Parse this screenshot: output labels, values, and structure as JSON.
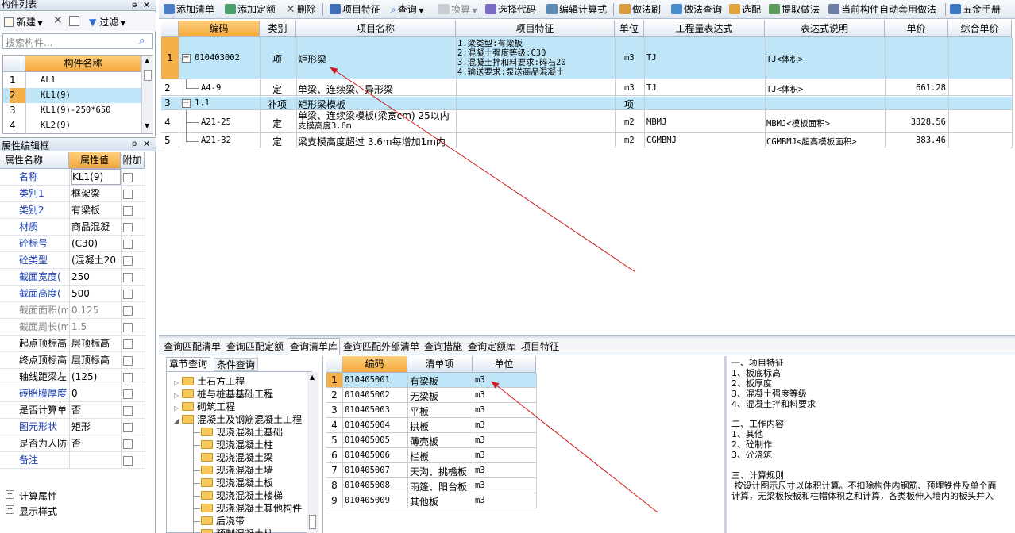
{
  "component_panel": {
    "title": "构件列表",
    "pin": "ᵽ",
    "close": "✕",
    "toolbar": {
      "new": "新建",
      "delete": "✕",
      "filter": "过滤"
    },
    "search_placeholder": "搜索构件...",
    "col_header": "构件名称",
    "items": [
      {
        "no": "1",
        "name": "AL1"
      },
      {
        "no": "2",
        "name": "KL1(9)"
      },
      {
        "no": "3",
        "name": "KL1(9)-250*650"
      },
      {
        "no": "4",
        "name": "KL2(9)"
      }
    ]
  },
  "property_panel": {
    "title": "属性编辑框",
    "headers": {
      "name": "属性名称",
      "value": "属性值",
      "extra": "附加"
    },
    "rows": [
      {
        "no": "1",
        "name": "名称",
        "value": "KL1(9)"
      },
      {
        "no": "2",
        "name": "类别1",
        "value": "框架梁"
      },
      {
        "no": "3",
        "name": "类别2",
        "value": "有梁板"
      },
      {
        "no": "4",
        "name": "材质",
        "value": "商品混凝"
      },
      {
        "no": "5",
        "name": "砼标号",
        "value": "(C30)"
      },
      {
        "no": "6",
        "name": "砼类型",
        "value": "(混凝土20"
      },
      {
        "no": "7",
        "name": "截面宽度(",
        "value": "250"
      },
      {
        "no": "8",
        "name": "截面高度(",
        "value": "500"
      },
      {
        "no": "9",
        "name": "截面面积(m",
        "value": "0.125"
      },
      {
        "no": "10",
        "name": "截面周长(m",
        "value": "1.5"
      },
      {
        "no": "11",
        "name": "起点顶标高",
        "value": "层顶标高"
      },
      {
        "no": "12",
        "name": "终点顶标高",
        "value": "层顶标高"
      },
      {
        "no": "13",
        "name": "轴线距梁左",
        "value": "(125)"
      },
      {
        "no": "14",
        "name": "砖胎膜厚度",
        "value": "0"
      },
      {
        "no": "15",
        "name": "是否计算单",
        "value": "否"
      },
      {
        "no": "16",
        "name": "图元形状",
        "value": "矩形"
      },
      {
        "no": "17",
        "name": "是否为人防",
        "value": "否"
      },
      {
        "no": "18",
        "name": "备注",
        "value": ""
      }
    ],
    "groups": [
      "计算属性",
      "显示样式"
    ]
  },
  "toolbar": {
    "add_list": "添加清单",
    "add_quota": "添加定额",
    "delete": "删除",
    "item_feature": "项目特征",
    "query": "查询",
    "convert": "换算",
    "select_code": "选择代码",
    "edit_formula": "编辑计算式",
    "brush": "做法刷",
    "method_query": "做法查询",
    "select_match": "选配",
    "extract_method": "提取做法",
    "auto_apply": "当前构件自动套用做法",
    "hardware_manual": "五金手册"
  },
  "main_table": {
    "headers": [
      "编码",
      "类别",
      "项目名称",
      "项目特征",
      "单位",
      "工程量表达式",
      "表达式说明",
      "单价",
      "综合单价"
    ],
    "rows": [
      {
        "no": "1",
        "code": "010403002",
        "type": "项",
        "name": "矩形梁",
        "features": [
          "1.梁类型:有梁板",
          "2.混凝土强度等级:C30",
          "3.混凝土拌和料要求:碎石20",
          "4.输送要求:泵送商品混凝土"
        ],
        "unit": "m3",
        "expr": "TJ",
        "desc": "TJ<体积>",
        "price": "",
        "comp": ""
      },
      {
        "no": "2",
        "code": "A4-9",
        "type": "定",
        "name": "单梁、连续梁、异形梁",
        "features": [],
        "unit": "m3",
        "expr": "TJ",
        "desc": "TJ<体积>",
        "price": "661.28",
        "comp": ""
      },
      {
        "no": "3",
        "code": "1.1",
        "type": "补项",
        "name": "矩形梁模板",
        "features": [],
        "unit": "项",
        "expr": "",
        "desc": "",
        "price": "",
        "comp": ""
      },
      {
        "no": "4",
        "code": "A21-25",
        "type": "定",
        "name": "单梁、连续梁模板(梁宽cm) 25以内",
        "name2": "支模高度3.6m",
        "features": [],
        "unit": "m2",
        "expr": "MBMJ",
        "desc": "MBMJ<模板面积>",
        "price": "3328.56",
        "comp": ""
      },
      {
        "no": "5",
        "code": "A21-32",
        "type": "定",
        "name": "梁支模高度超过 3.6m每增加1m内",
        "features": [],
        "unit": "m2",
        "expr": "CGMBMJ",
        "desc": "CGMBMJ<超高模板面积>",
        "price": "383.46",
        "comp": ""
      }
    ]
  },
  "bottom_tabs": [
    "查询匹配清单",
    "查询匹配定额",
    "查询清单库",
    "查询匹配外部清单",
    "查询措施",
    "查询定额库",
    "项目特征"
  ],
  "tree_panel": {
    "tabs": [
      "章节查询",
      "条件查询"
    ],
    "top_nodes": [
      "土石方工程",
      "桩与桩基基础工程",
      "砌筑工程",
      "混凝土及钢筋混凝土工程"
    ],
    "children": [
      "现浇混凝土基础",
      "现浇混凝土柱",
      "现浇混凝土梁",
      "现浇混凝土墙",
      "现浇混凝土板",
      "现浇混凝土楼梯",
      "现浇混凝土其他构件",
      "后浇带",
      "预制混凝土柱"
    ]
  },
  "library_table": {
    "headers": [
      "编码",
      "清单项",
      "单位"
    ],
    "rows": [
      {
        "no": "1",
        "code": "010405001",
        "item": "有梁板",
        "unit": "m3"
      },
      {
        "no": "2",
        "code": "010405002",
        "item": "无梁板",
        "unit": "m3"
      },
      {
        "no": "3",
        "code": "010405003",
        "item": "平板",
        "unit": "m3"
      },
      {
        "no": "4",
        "code": "010405004",
        "item": "拱板",
        "unit": "m3"
      },
      {
        "no": "5",
        "code": "010405005",
        "item": "薄壳板",
        "unit": "m3"
      },
      {
        "no": "6",
        "code": "010405006",
        "item": "栏板",
        "unit": "m3"
      },
      {
        "no": "7",
        "code": "010405007",
        "item": "天沟、挑檐板",
        "unit": "m3"
      },
      {
        "no": "8",
        "code": "010405008",
        "item": "雨篷、阳台板",
        "unit": "m3"
      },
      {
        "no": "9",
        "code": "010405009",
        "item": "其他板",
        "unit": "m3"
      }
    ]
  },
  "description": {
    "lines": [
      "一、项目特征",
      "1、板底标高",
      "2、板厚度",
      "3、混凝土强度等级",
      "4、混凝土拌和料要求",
      "",
      "二、工作内容",
      "1、其他",
      "2、砼制作",
      "3、砼浇筑",
      "",
      "三、计算规则",
      " 按设计图示尺寸以体积计算。不扣除构件内钢筋、预埋铁件及单个面",
      "计算，无梁板按板和柱帽体积之和计算，各类板伸入墙内的板头并入"
    ]
  },
  "colors": {
    "selected_row": "#bfe6f8",
    "orange_header": "#f5b04a",
    "prop_name": "#1a3fb3",
    "annotation": "#d11a1a"
  }
}
